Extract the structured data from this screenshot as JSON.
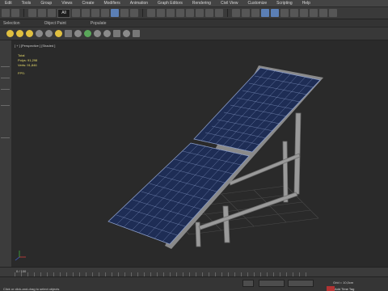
{
  "menubar": {
    "items": [
      "Edit",
      "Tools",
      "Group",
      "Views",
      "Create",
      "Modifiers",
      "Animation",
      "Graph Editors",
      "Rendering",
      "Civil View",
      "Customize",
      "Scripting",
      "Help"
    ]
  },
  "toolbar": {
    "selection_filter": "All"
  },
  "ribbon": {
    "tabs": [
      "Selection",
      "Object Paint",
      "Populate"
    ]
  },
  "viewport": {
    "label": "[ + ] [Perspective ] [Shaded ]",
    "stats_title": "Total",
    "polys_label": "Polys:",
    "polys_value": "91,298",
    "verts_label": "Verts:",
    "verts_value": "91,846",
    "fps_label": "FPS:"
  },
  "timeline": {
    "frame_counter": "0 / 100"
  },
  "statusbar": {
    "status_text": "Click or click-and-drag to select objects",
    "grid_value": "Grid = 10,0cm",
    "auto_key": "Auto Key",
    "add_time_tag": "Add Time Tag"
  },
  "colors": {
    "panel_blue": "#1e2d55",
    "panel_cell_line": "#8a9cc8",
    "frame_gray": "#9a9a9a",
    "stats_yellow": "#e8dc6a"
  }
}
